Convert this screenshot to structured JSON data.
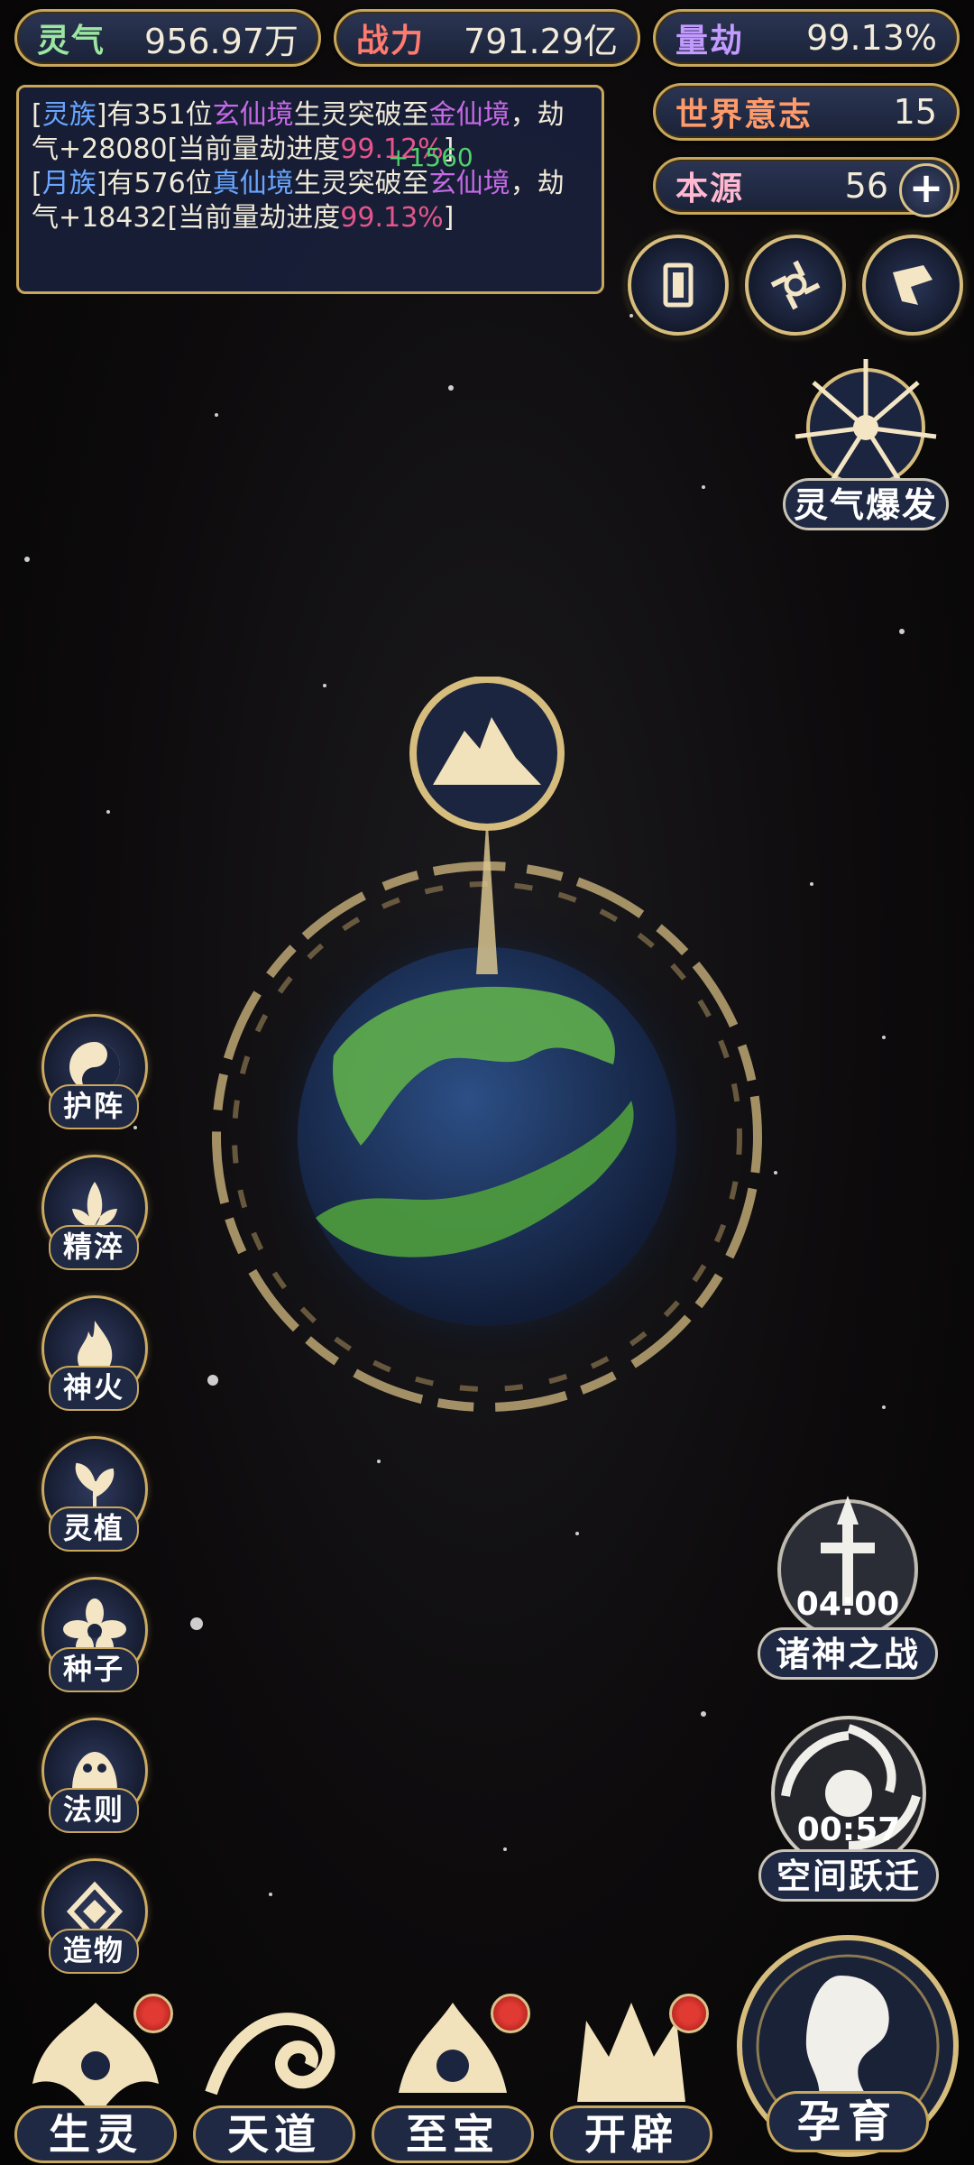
{
  "top_bar": {
    "aura": {
      "label": "灵气",
      "value": "956.97万"
    },
    "power": {
      "label": "战力",
      "value": "791.29亿"
    },
    "kalpa": {
      "label": "量劫",
      "value": "99.13%"
    },
    "world_will": {
      "label": "世界意志",
      "value": "15"
    },
    "origin": {
      "label": "本源",
      "value": "56",
      "plus": "+"
    }
  },
  "event_log": {
    "line1": {
      "open": "[",
      "race": "灵族",
      "mid": "]有351位",
      "realm_from": "玄仙境",
      "mid2": "生灵突破至",
      "realm_to": "金仙境",
      "tail": "，劫气+28080[当前量劫进度",
      "progress": "99.12%",
      "close": "]"
    },
    "line2": {
      "open": "[",
      "race": "月族",
      "mid": "]有576位",
      "realm_from": "真仙境",
      "mid2": "生灵突破至",
      "realm_to": "玄仙境",
      "tail": "，劫气+18432[当前量劫进度",
      "progress": "99.13%",
      "close": "]"
    },
    "floating_number": "+1560"
  },
  "buttons": {
    "aura_burst": "灵气爆发",
    "side": [
      "护阵",
      "精淬",
      "神火",
      "灵植",
      "种子",
      "法则",
      "造物"
    ],
    "war_of_gods": {
      "label": "诸神之战",
      "timer": "04:00"
    },
    "space_jump": {
      "label": "空间跃迁",
      "timer": "00:57"
    },
    "bottom": [
      "生灵",
      "天道",
      "至宝",
      "开辟"
    ],
    "breed": "孕育"
  },
  "colors": {
    "gold": "#c8a75c",
    "panel": "#1f2944",
    "red_badge": "#e03a33"
  }
}
